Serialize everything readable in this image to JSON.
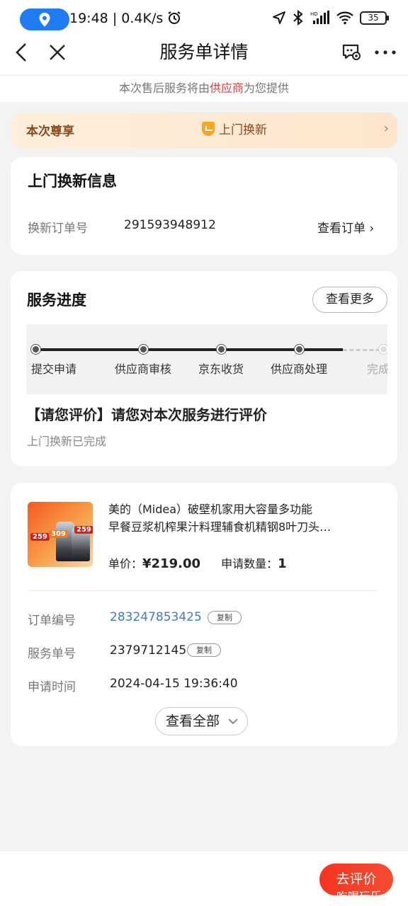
{
  "status_bar": {
    "time": "19:48",
    "network_speed": "0.4K/s",
    "battery": "35",
    "icons": [
      "location-pin-icon",
      "alarm-icon",
      "navigation-icon",
      "bluetooth-icon",
      "hd-signal-icon",
      "wifi-icon",
      "battery-icon"
    ]
  },
  "nav": {
    "title": "服务单详情",
    "back_icon": "chevron-left-icon",
    "close_icon": "close-icon",
    "service_icon": "chat-settings-icon",
    "more_icon": "more-icon"
  },
  "notice": {
    "prefix": "本次售后服务将由",
    "highlight": "供应商",
    "suffix": "为您提供"
  },
  "privilege": {
    "label": "本次尊享",
    "service": "上门换新",
    "arrow": "›"
  },
  "exchange_info": {
    "title": "上门换新信息",
    "order_label": "换新订单号",
    "order_number": "291593948912",
    "view_order": "查看订单 ›"
  },
  "progress": {
    "title": "服务进度",
    "more_button": "查看更多",
    "steps": [
      {
        "label": "提交申请",
        "done": true
      },
      {
        "label": "供应商审核",
        "done": true
      },
      {
        "label": "京东收货",
        "done": true
      },
      {
        "label": "供应商处理",
        "done": true
      },
      {
        "label": "完成",
        "done": false
      }
    ],
    "eval_title": "【请您评价】请您对本次服务进行评价",
    "eval_subtitle": "上门换新已完成"
  },
  "product": {
    "name_line1": "美的（Midea）破壁机家用大容量多功能",
    "name_line2": "早餐豆浆机榨果汁料理辅食机精钢8叶刀头…",
    "price_label": "单价：",
    "price": "¥219.00",
    "qty_label": "申请数量：",
    "qty": "1",
    "thumb_tags": [
      "259",
      "309",
      "259"
    ],
    "order_no_label": "订单编号",
    "order_no": "283247853425",
    "service_no_label": "服务单号",
    "service_no": "2379712145",
    "apply_time_label": "申请时间",
    "apply_time": "2024-04-15 19:36:40",
    "copy_label": "复制",
    "view_all": "查看全部",
    "view_all_icon": "chevron-down-icon"
  },
  "bottom": {
    "evaluate_button": "去评价",
    "overlay_text": "吃喝玩乐"
  }
}
